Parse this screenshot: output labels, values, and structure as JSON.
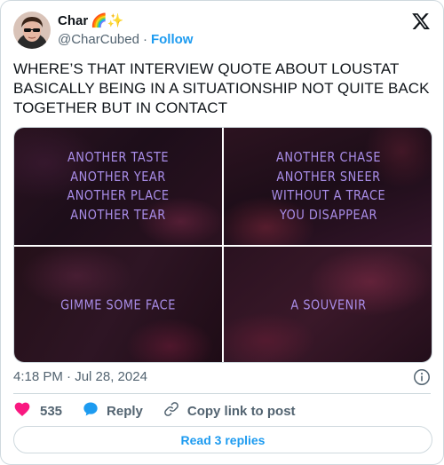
{
  "author": {
    "display_name": "Char",
    "name_emojis": "🌈✨",
    "handle": "@CharCubed",
    "separator": "·",
    "follow_label": "Follow"
  },
  "tweet": {
    "text": "WHERE’S THAT INTERVIEW QUOTE ABOUT LOUSTAT BASICALLY BEING IN A SITUATIONSHIP NOT QUITE BACK TOGETHER BUT IN CONTACT"
  },
  "media": {
    "tiles": [
      {
        "lines": [
          "ANOTHER TASTE",
          "ANOTHER YEAR",
          "ANOTHER PLACE",
          "ANOTHER TEAR"
        ]
      },
      {
        "lines": [
          "ANOTHER CHASE",
          "ANOTHER SNEER",
          "WITHOUT A TRACE",
          "YOU DISAPPEAR"
        ]
      },
      {
        "lines": [
          "GIMME SOME FACE"
        ]
      },
      {
        "lines": [
          "A SOUVENIR"
        ]
      }
    ],
    "caption_color": "#a98de8"
  },
  "meta": {
    "timestamp": "4:18 PM · Jul 28, 2024"
  },
  "actions": {
    "like_count": "535",
    "reply_label": "Reply",
    "copy_label": "Copy link to post"
  },
  "replies_button": {
    "label": "Read 3 replies"
  },
  "colors": {
    "accent": "#1d9bf0",
    "like": "#f91880",
    "secondary_text": "#536471",
    "border": "#cfd9de"
  },
  "icons": {
    "x_logo": "x-logo-icon",
    "info": "info-icon",
    "heart": "heart-icon",
    "reply": "reply-bubble-icon",
    "copy": "link-icon"
  }
}
